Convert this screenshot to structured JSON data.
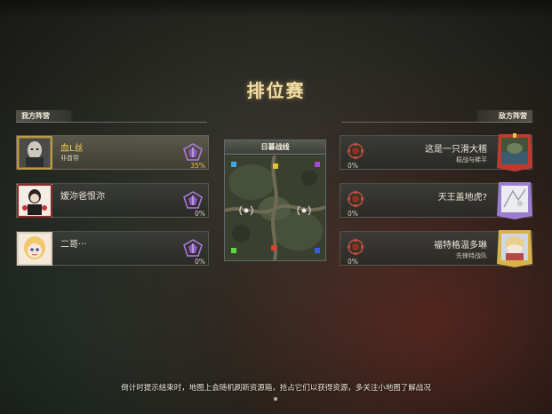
{
  "title": "排位赛",
  "team_left_label": "我方阵营",
  "team_right_label": "敌方阵营",
  "map": {
    "title": "日暮战线"
  },
  "left_players": [
    {
      "name": "血L丝",
      "subtitle": "非酋帮",
      "percent": "35%",
      "highlight": true
    },
    {
      "name": "嫒沵爸恨沵",
      "subtitle": "",
      "percent": "0%",
      "highlight": false
    },
    {
      "name": "二哥···",
      "subtitle": "",
      "percent": "0%",
      "highlight": false
    }
  ],
  "right_players": [
    {
      "name": "这是一只滑大稽",
      "subtitle": "稳战与稀平",
      "percent": "0%"
    },
    {
      "name": "天王盖地虎?",
      "subtitle": "",
      "percent": "0%"
    },
    {
      "name": "福特格温多琳",
      "subtitle": "先锋特战队",
      "percent": "0%"
    }
  ],
  "footer_tip": "倒计时提示结束时，地图上会随机刷新资源箱，抢占它们以获得资源，多关注小地图了解战况",
  "colors": {
    "accent_gold": "#e8c052",
    "rank_purple": "#b07ce0",
    "rank_red": "#c0503c",
    "map_markers": [
      "#3aa8e8",
      "#e8c030",
      "#b044d8",
      "#5ed840",
      "#e04030",
      "#3a5ae0"
    ]
  }
}
